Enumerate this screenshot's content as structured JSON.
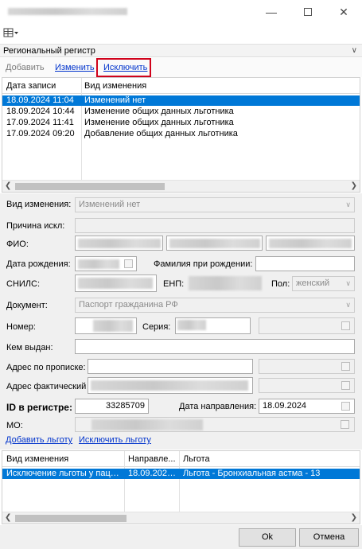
{
  "window": {
    "minimize_icon": "minimize-icon",
    "maximize_icon": "maximize-icon",
    "close_icon": "close-icon"
  },
  "toolbar": {
    "icon": "table-menu-icon"
  },
  "region_bar": {
    "title": "Региональный регистр",
    "chevron": "chevron-down-icon"
  },
  "actions": {
    "add": "Добавить",
    "edit": "Изменить",
    "exclude": "Исключить"
  },
  "history_table": {
    "columns": [
      "Дата записи",
      "Вид изменения"
    ],
    "rows": [
      {
        "date": "18.09.2024 11:04",
        "kind": "Изменений нет",
        "selected": true
      },
      {
        "date": "18.09.2024 10:44",
        "kind": "Изменение общих данных льготника",
        "selected": false
      },
      {
        "date": "17.09.2024 11:41",
        "kind": "Изменение общих данных льготника",
        "selected": false
      },
      {
        "date": "17.09.2024 09:20",
        "kind": "Добавление общих данных льготника",
        "selected": false
      }
    ]
  },
  "form": {
    "change_kind_label": "Вид изменения:",
    "change_kind_value": "Изменений нет",
    "exclusion_reason_label": "Причина искл:",
    "fio_label": "ФИО:",
    "birth_date_label": "Дата рождения:",
    "birth_surname_label": "Фамилия при рождении:",
    "snils_label": "СНИЛС:",
    "enp_label": "ЕНП:",
    "gender_label": "Пол:",
    "gender_value": "женский",
    "document_label": "Документ:",
    "document_value": "Паспорт гражданина РФ",
    "number_label": "Номер:",
    "series_label": "Серия:",
    "issued_by_label": "Кем выдан:",
    "reg_address_label": "Адрес по прописке:",
    "actual_address_label": "Адрес фактический",
    "registry_id_label": "ID в регистре:",
    "registry_id_value": "33285709",
    "referral_date_label": "Дата направления:",
    "referral_date_value": "18.09.2024",
    "mo_label": "МО:"
  },
  "benefit_links": {
    "add": "Добавить льготу",
    "exclude": "Исключить льготу"
  },
  "benefit_table": {
    "columns": [
      "Вид изменения",
      "Направле...",
      "Льгота"
    ],
    "rows": [
      {
        "kind": "Исключение льготы у пацие...",
        "direction": "18.09.2024...",
        "benefit": "Льгота - Бронхиальная астма - 13",
        "selected": true
      }
    ]
  },
  "buttons": {
    "ok": "Ok",
    "cancel": "Отмена"
  },
  "colors": {
    "selection": "#0078d7",
    "link": "#0033cc",
    "highlight": "#d0021b"
  }
}
